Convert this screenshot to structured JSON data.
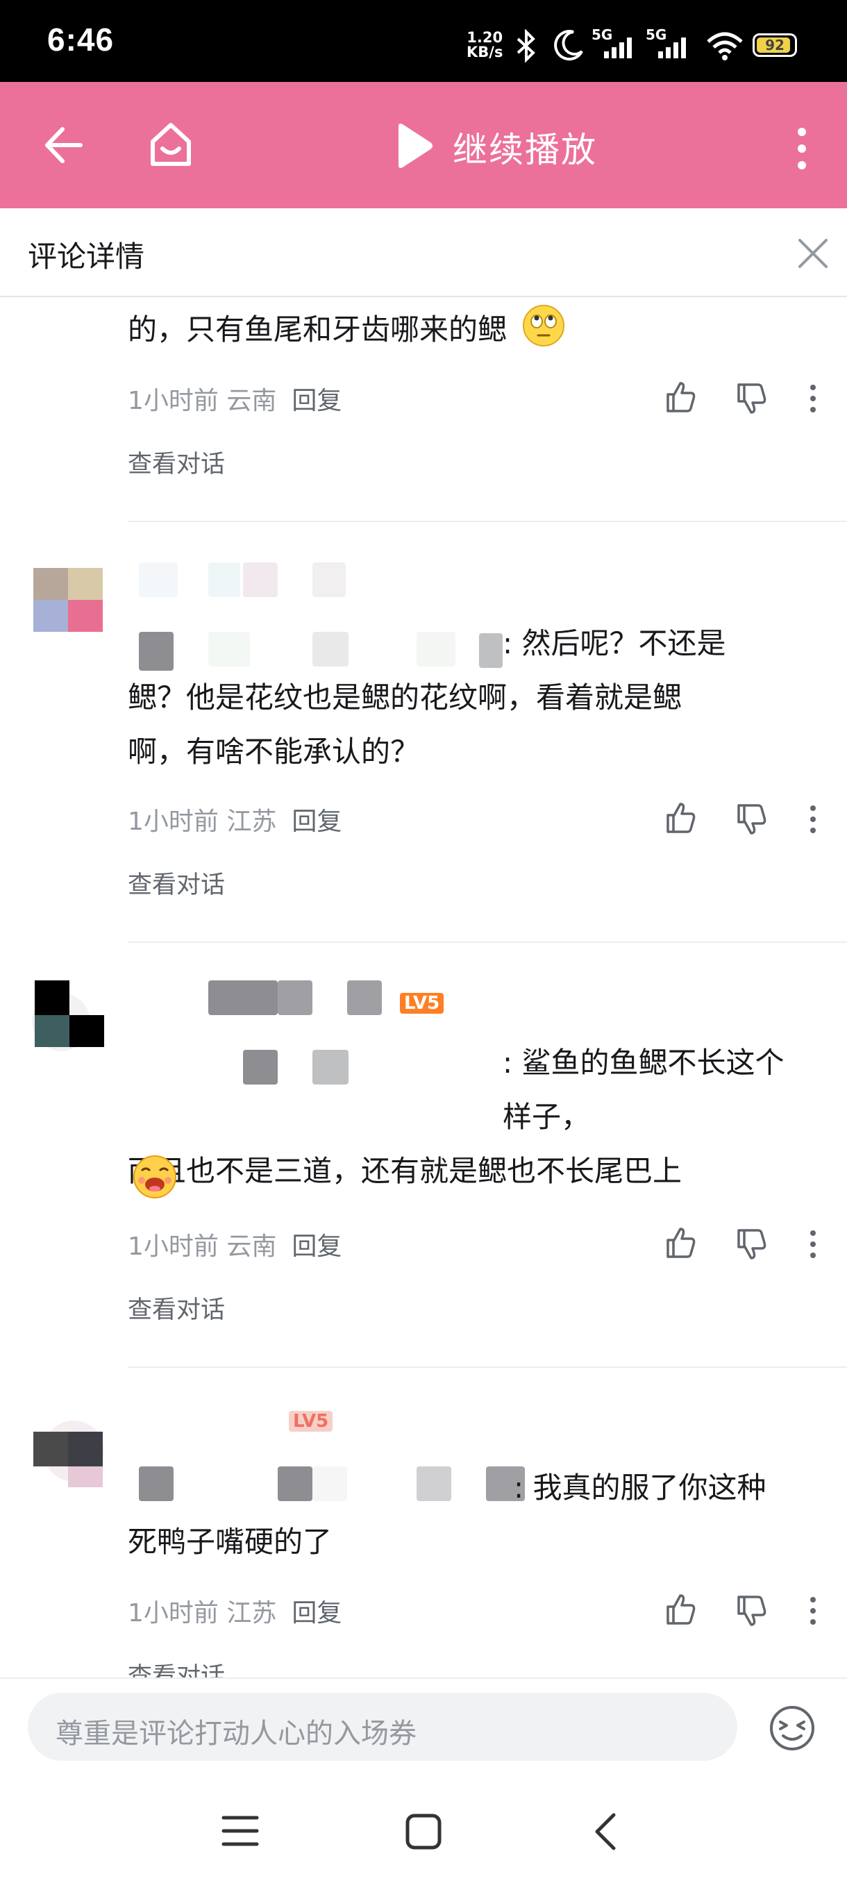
{
  "status_bar": {
    "time": "6:46",
    "net_speed_value": "1.20",
    "net_speed_unit": "KB/s",
    "network_label_1": "5G",
    "network_label_2": "5G",
    "battery_level": "92"
  },
  "header": {
    "continue_label": "继续播放",
    "colors": {
      "header_bg": "#ec719a"
    }
  },
  "panel": {
    "title": "评论详情"
  },
  "comments": [
    {
      "text": "的，只有鱼尾和牙齿哪来的鳃",
      "emoji": "rolling-eyes-emoji",
      "time": "1小时前",
      "location": "云南",
      "reply_label": "回复",
      "view_conversation": "查看对话"
    },
    {
      "text_line1": ": 然后呢？不还是",
      "text_line2": "鳃？他是花纹也是鳃的花纹啊，看着就是鳃",
      "text_line3": "啊，有啥不能承认的？",
      "time": "1小时前",
      "location": "江苏",
      "reply_label": "回复",
      "view_conversation": "查看对话"
    },
    {
      "level_badge": "LV5",
      "text_line1": ": 鲨鱼的鱼鳃不长这个样子，",
      "text_line2": "而且也不是三道，还有就是鳃也不长尾巴上",
      "emoji": "sticker-emoji",
      "time": "1小时前",
      "location": "云南",
      "reply_label": "回复",
      "view_conversation": "查看对话"
    },
    {
      "text_line1": ": 我真的服了你这种",
      "text_line2": "死鸭子嘴硬的了",
      "time": "1小时前",
      "location": "江苏",
      "reply_label": "回复",
      "view_conversation": "查看对话"
    }
  ],
  "input": {
    "placeholder": "尊重是评论打动人心的入场券"
  }
}
